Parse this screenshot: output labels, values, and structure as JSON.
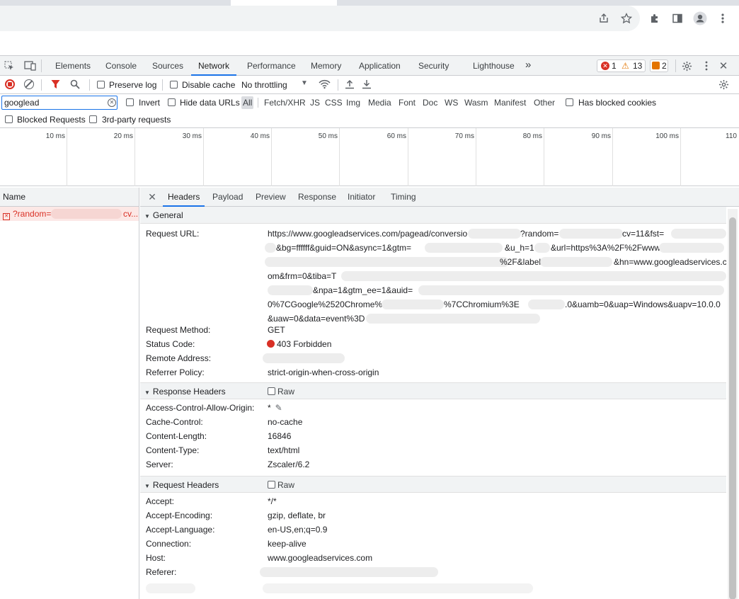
{
  "devtools": {
    "tabs": [
      "Elements",
      "Console",
      "Sources",
      "Network",
      "Performance",
      "Memory",
      "Application",
      "Security",
      "Lighthouse"
    ],
    "active_tab": "Network",
    "more_tabs": "»",
    "error_count": "1",
    "warning_count": "13",
    "issue_count": "2"
  },
  "network_toolbar": {
    "preserve_log": "Preserve log",
    "disable_cache": "Disable cache",
    "throttling": "No throttling"
  },
  "filter": {
    "value": "googlead",
    "invert": "Invert",
    "hide_data_urls": "Hide data URLs",
    "types": [
      "All",
      "Fetch/XHR",
      "JS",
      "CSS",
      "Img",
      "Media",
      "Font",
      "Doc",
      "WS",
      "Wasm",
      "Manifest",
      "Other"
    ],
    "active_type": "All",
    "has_blocked_cookies": "Has blocked cookies",
    "blocked_requests": "Blocked Requests",
    "third_party": "3rd-party requests"
  },
  "timeline": {
    "ticks": [
      "10 ms",
      "20 ms",
      "30 ms",
      "40 ms",
      "50 ms",
      "60 ms",
      "70 ms",
      "80 ms",
      "90 ms",
      "100 ms",
      "110"
    ]
  },
  "requests": {
    "column_name": "Name",
    "rows": [
      {
        "name": "?random=",
        "suffix": "cv..."
      }
    ]
  },
  "detail": {
    "tabs": [
      "Headers",
      "Payload",
      "Preview",
      "Response",
      "Initiator",
      "Timing"
    ],
    "active_tab": "Headers",
    "general": {
      "title": "General",
      "request_url_label": "Request URL:",
      "url_lines": [
        "https://www.googleadservices.com/pagead/conversio",
        "&bg=ffffff&guid=ON&async=1&gtm=",
        "",
        "om&frm=0&tiba=T",
        "&npa=1&gtm_ee=1&auid=",
        "0%7CGoogle%2520Chrome%3",
        "&uaw=0&data=event%3D"
      ],
      "url_fragments": {
        "l1_random": "?random=",
        "l1_cv": "cv=11&fst=",
        "l2_uh": "&u_h=1",
        "l2_url": "&url=https%3A%2F%2Fwww",
        "l3_label": "%2F&label=",
        "l3_hn": "&hn=www.googleadservices.c",
        "l6_chromium": "%7CChromium%3E",
        "l6_tail": ".0&uamb=0&uap=Windows&uapv=10.0.0"
      },
      "request_method_label": "Request Method:",
      "request_method": "GET",
      "status_code_label": "Status Code:",
      "status_code": "403 Forbidden",
      "remote_address_label": "Remote Address:",
      "referrer_policy_label": "Referrer Policy:",
      "referrer_policy": "strict-origin-when-cross-origin"
    },
    "response_headers": {
      "title": "Response Headers",
      "raw": "Raw",
      "items": [
        {
          "k": "Access-Control-Allow-Origin:",
          "v": "*"
        },
        {
          "k": "Cache-Control:",
          "v": "no-cache"
        },
        {
          "k": "Content-Length:",
          "v": "16846"
        },
        {
          "k": "Content-Type:",
          "v": "text/html"
        },
        {
          "k": "Server:",
          "v": "Zscaler/6.2"
        }
      ]
    },
    "request_headers": {
      "title": "Request Headers",
      "raw": "Raw",
      "items": [
        {
          "k": "Accept:",
          "v": "*/*"
        },
        {
          "k": "Accept-Encoding:",
          "v": "gzip, deflate, br"
        },
        {
          "k": "Accept-Language:",
          "v": "en-US,en;q=0.9"
        },
        {
          "k": "Connection:",
          "v": "keep-alive"
        },
        {
          "k": "Host:",
          "v": "www.googleadservices.com"
        },
        {
          "k": "Referer:",
          "v": ""
        }
      ]
    }
  }
}
